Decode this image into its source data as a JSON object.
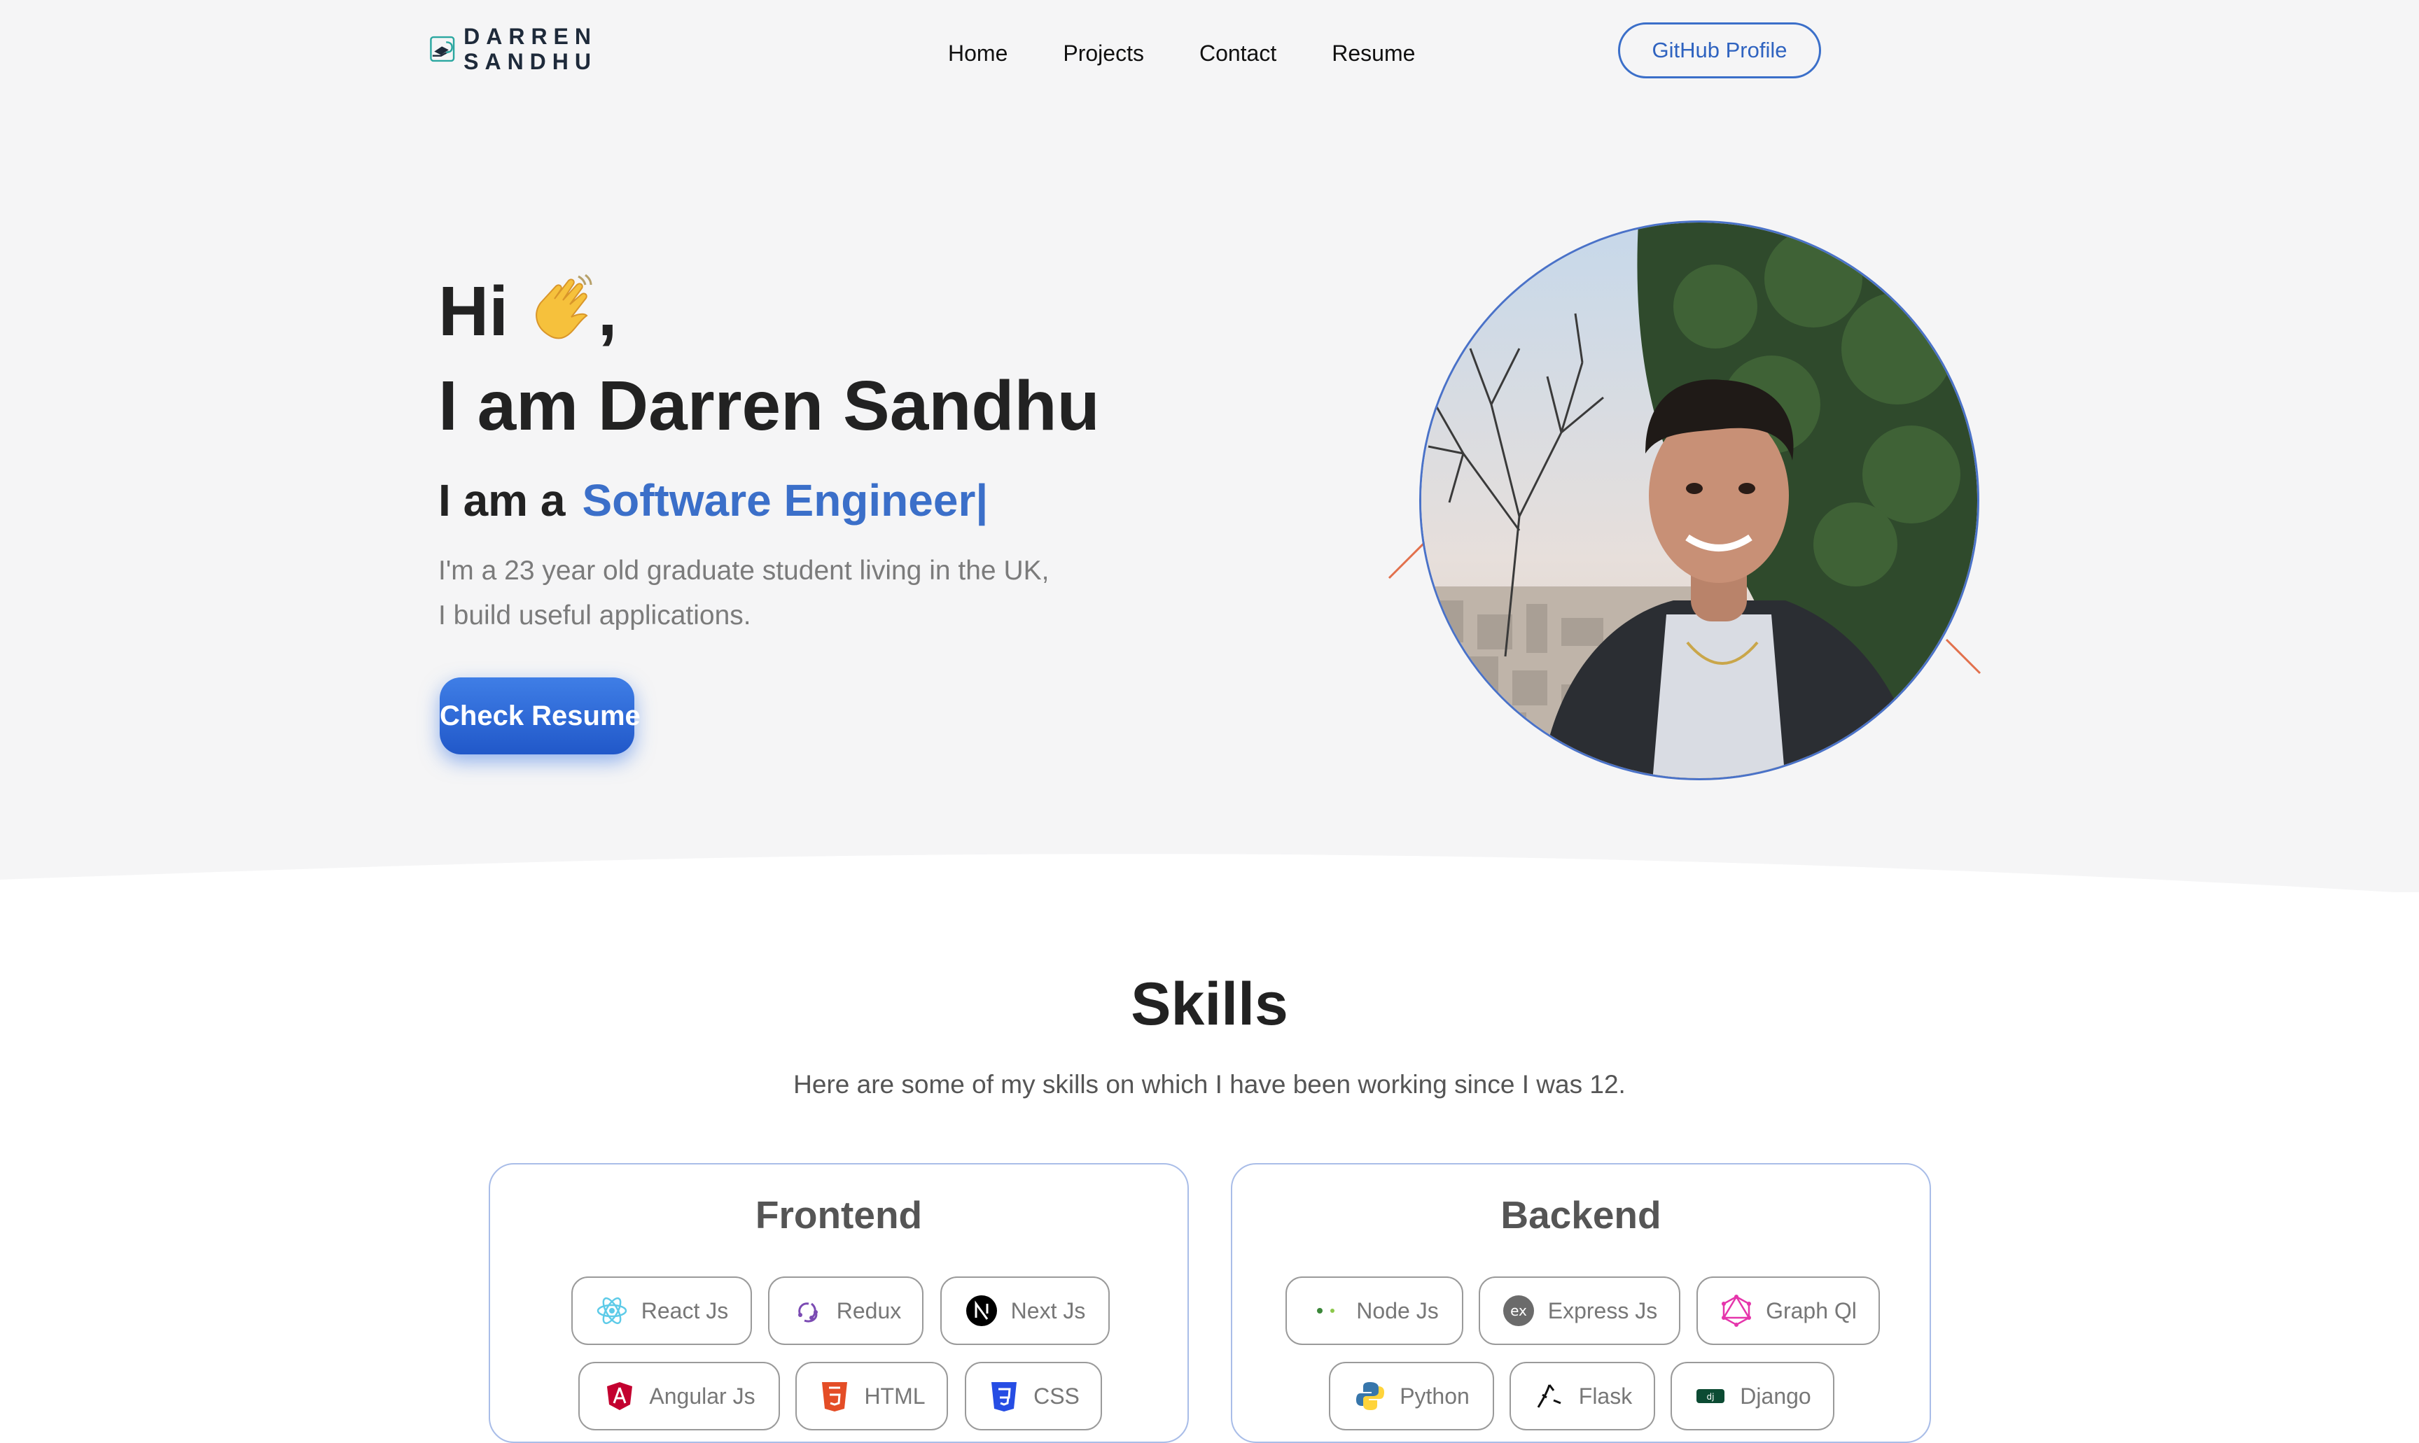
{
  "brand": {
    "line1": "DARREN",
    "line2": "SANDHU"
  },
  "nav": [
    {
      "label": "Home"
    },
    {
      "label": "Projects"
    },
    {
      "label": "Contact"
    },
    {
      "label": "Resume"
    }
  ],
  "github_button": "GitHub Profile",
  "hero": {
    "greeting": "Hi",
    "greeting_suffix": ",",
    "name_line": "I am Darren Sandhu",
    "role_prefix": "I am a",
    "role_typed": "Software Engineer|",
    "desc_line1": "I'm a 23 year old graduate student living in the UK,",
    "desc_line2": "I build useful applications.",
    "cta": "Check Resume"
  },
  "skills": {
    "title": "Skills",
    "subtitle": "Here are some of my skills on which I have been working since I was 12.",
    "frontend": {
      "title": "Frontend",
      "items": [
        "React Js",
        "Redux",
        "Next Js",
        "Angular Js",
        "HTML",
        "CSS"
      ]
    },
    "backend": {
      "title": "Backend",
      "items": [
        "Node Js",
        "Express Js",
        "Graph Ql",
        "Python",
        "Flask",
        "Django"
      ]
    }
  },
  "colors": {
    "accent": "#3b6fc9",
    "hero_bg": "#f5f5f6",
    "card_border": "#a9bde8"
  }
}
